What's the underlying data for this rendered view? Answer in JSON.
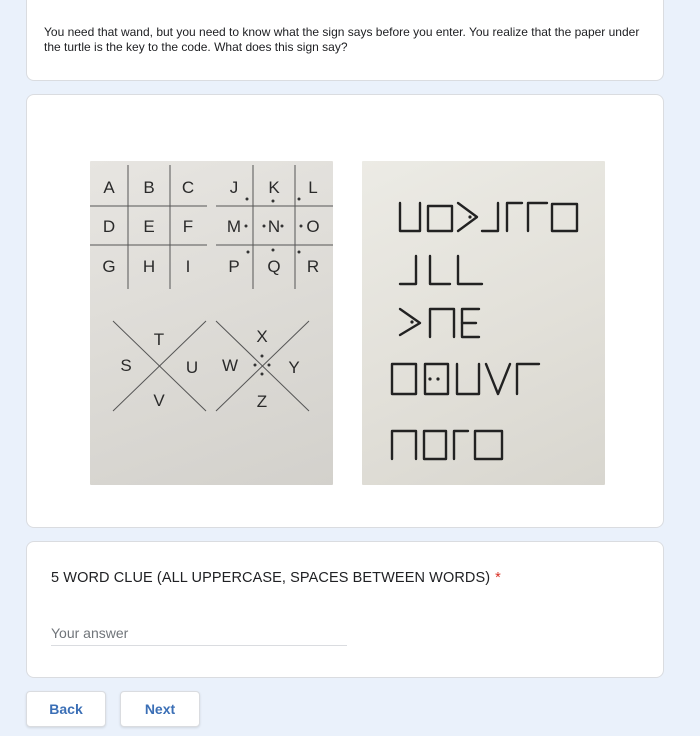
{
  "description": {
    "text": "You need that wand, but you need to know what the sign says before you enter. You realize that the paper under the turtle is the key to the code. What does this sign say?"
  },
  "images": {
    "key_letters": {
      "grid1": [
        "A",
        "B",
        "C",
        "D",
        "E",
        "F",
        "G",
        "H",
        "I"
      ],
      "grid2": [
        "J",
        "K",
        "L",
        "M",
        "N",
        "O",
        "P",
        "Q",
        "R"
      ],
      "x1": [
        "T",
        "S",
        "U",
        "V"
      ],
      "x2": [
        "X",
        "W",
        "Y",
        "Z"
      ]
    }
  },
  "question": {
    "title": "5 WORD CLUE (ALL UPPERCASE, SPACES BETWEEN WORDS)",
    "required_mark": "*",
    "placeholder": "Your answer",
    "value": ""
  },
  "nav": {
    "back_label": "Back",
    "next_label": "Next"
  }
}
